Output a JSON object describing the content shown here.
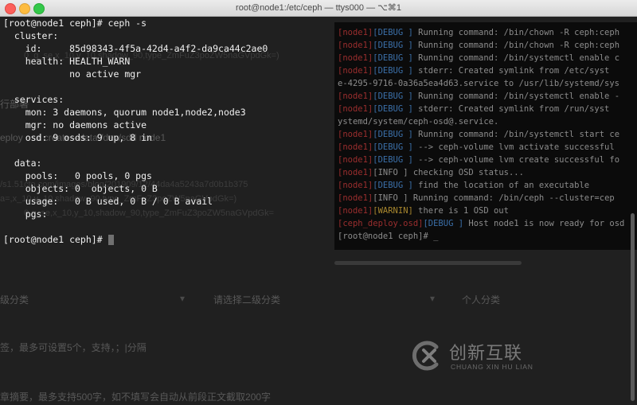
{
  "window": {
    "title": "root@node1:/etc/ceph — ttys000 — ⌥⌘1"
  },
  "terminal": {
    "lines": [
      "[root@node1 ceph]# ceph -s",
      "  cluster:",
      "    id:     85d98343-4f5a-42d4-a4f2-da9ca44c2ae0",
      "    health: HEALTH_WARN",
      "            no active mgr",
      "",
      "  services:",
      "    mon: 3 daemons, quorum node1,node2,node3",
      "    mgr: no daemons active",
      "    osd: 9 osds: 9 up, 8 in",
      "",
      "  data:",
      "    pools:   0 pools, 0 pgs",
      "    objects: 0  objects, 0 B",
      "    usage:   0 B used, 0 B / 0 B avail",
      "    pgs:",
      "",
      "[root@node1 ceph]# "
    ]
  },
  "log": {
    "lines": [
      {
        "tag": "[node1]",
        "lvl": "[DEBUG ]",
        "lvlclass": "",
        "msg": " Running command: /bin/chown -R ceph:ceph"
      },
      {
        "tag": "[node1]",
        "lvl": "[DEBUG ]",
        "lvlclass": "",
        "msg": " Running command: /bin/chown -R ceph:ceph"
      },
      {
        "tag": "[node1]",
        "lvl": "[DEBUG ]",
        "lvlclass": "",
        "msg": " Running command: /bin/systemctl enable c"
      },
      {
        "tag": "[node1]",
        "lvl": "[DEBUG ]",
        "lvlclass": "",
        "msg": "  stderr: Created symlink from /etc/syst"
      },
      {
        "tag": "",
        "lvl": "",
        "lvlclass": "",
        "msg": "e-4295-9716-0a36a5ea4d63.service to /usr/lib/systemd/sys"
      },
      {
        "tag": "[node1]",
        "lvl": "[DEBUG ]",
        "lvlclass": "",
        "msg": " Running command: /bin/systemctl enable -"
      },
      {
        "tag": "[node1]",
        "lvl": "[DEBUG ]",
        "lvlclass": "",
        "msg": "  stderr: Created symlink from /run/syst"
      },
      {
        "tag": "",
        "lvl": "",
        "lvlclass": "",
        "msg": "ystemd/system/ceph-osd@.service."
      },
      {
        "tag": "[node1]",
        "lvl": "[DEBUG ]",
        "lvlclass": "",
        "msg": " Running command: /bin/systemctl start ce"
      },
      {
        "tag": "[node1]",
        "lvl": "[DEBUG ]",
        "lvlclass": "",
        "msg": " --> ceph-volume lvm activate successful"
      },
      {
        "tag": "[node1]",
        "lvl": "[DEBUG ]",
        "lvlclass": "",
        "msg": " --> ceph-volume lvm create successful fo"
      },
      {
        "tag": "[node1]",
        "lvl": "[INFO  ]",
        "lvlclass": "info",
        "msg": " checking OSD status..."
      },
      {
        "tag": "[node1]",
        "lvl": "[DEBUG ]",
        "lvlclass": "",
        "msg": " find the location of an executable"
      },
      {
        "tag": "[node1]",
        "lvl": "[INFO  ]",
        "lvlclass": "info",
        "msg": " Running command: /bin/ceph --cluster=cep"
      },
      {
        "tag": "[node1]",
        "lvl": "[WARNIN]",
        "lvlclass": "warn",
        "msg": " there is 1 OSD out"
      },
      {
        "tag": "[ceph_deploy.osd]",
        "lvl": "[DEBUG ]",
        "lvlclass": "",
        "msg": " Host node1 is now ready for osd"
      },
      {
        "tag": "",
        "lvl": "",
        "lvlclass": "",
        "msg": "[root@node1 ceph]# _"
      }
    ]
  },
  "background": {
    "ghost_texts": [
      "行部署",
      "eploy osd create --data /dev/sdd node1",
      "级分类",
      "请选择二级分类",
      "个人分类",
      "签，最多可设置5个，支持，；|分隔",
      "章摘要，最多支持500字，如不填写会自动从前段正文截取200字"
    ],
    "dim_texts": [
      "0_g_se,x_10,y_10,shadow_90,type_ZmFuZ3poZW5naGVpdGk=)",
      "/s1.51cto.com/images/blog/201909/12/44da4a5243a7d0b1b375",
      "a=,x_10,y_10,shadow_90,type_ZmFuZ3poZW5naGVpdGk=)",
      "0,g_se,x_10,y_10,shadow_90,type_ZmFuZ3poZW5naGVpdGk="
    ]
  },
  "watermark": {
    "cn": "创新互联",
    "en": "CHUANG XIN HU LIAN"
  }
}
